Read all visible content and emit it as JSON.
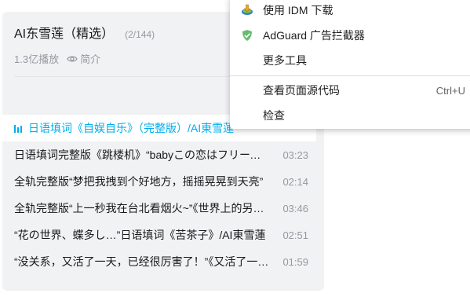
{
  "playlist": {
    "title": "AI东雪莲（精选）",
    "count": "(2/144)",
    "plays": "1.3亿播放",
    "intro_label": "简介",
    "items": [
      {
        "label": "日语填词《自娱自乐》（完整版）/AI東雪蓮",
        "duration": ""
      },
      {
        "label": "日语填词完整版《跳楼机》“babyこの恋はフリーフォール”",
        "duration": "03:23"
      },
      {
        "label": "全轨完整版“梦把我拽到个好地方，摇摇晃晃到天亮”",
        "duration": "02:14"
      },
      {
        "label": "全轨完整版“上一秒我在台北看烟火~”《世界上的另一个我》",
        "duration": "03:46"
      },
      {
        "label": "“花の世界、蝶多し…”日语填词《苦茶子》/AI東雪蓮",
        "duration": "02:51"
      },
      {
        "label": "“没关系，又活了一天，已经很厉害了！”《又活了一天》",
        "duration": "01:59"
      }
    ]
  },
  "context_menu": {
    "items": [
      {
        "label": "使用 IDM 下载",
        "icon": "idm-icon"
      },
      {
        "label": "AdGuard 广告拦截器",
        "icon": "adguard-shield-icon",
        "submenu": true
      },
      {
        "label": "更多工具",
        "submenu": true
      },
      {
        "label": "查看页面源代码",
        "shortcut": "Ctrl+U"
      },
      {
        "label": "检查"
      }
    ]
  },
  "colors": {
    "accent": "#00aeec",
    "panel_bg": "#f1f2f3",
    "muted_text": "#9499a0",
    "adguard_green": "#68bc71"
  }
}
